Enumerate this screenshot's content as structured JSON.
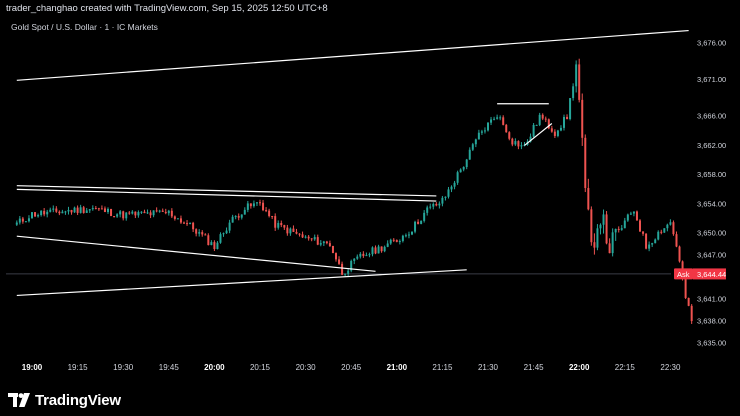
{
  "header": {
    "caption": "trader_changhao created with TradingView.com, Sep 15, 2025 12:50 UTC+8"
  },
  "footer": {
    "brand": "TradingView"
  },
  "chart_data": {
    "type": "candlestick",
    "title": "Gold Spot / U.S. Dollar · 1 · IC Markets",
    "symbol": "Gold Spot / U.S. Dollar",
    "interval": "1",
    "source": "IC Markets",
    "ylim": [
      3633.0,
      3678.0
    ],
    "y_ticks": [
      3676.0,
      3671.0,
      3666.0,
      3662.0,
      3658.0,
      3654.0,
      3650.0,
      3647.0,
      3641.0,
      3638.0,
      3635.0
    ],
    "y_tick_labels": [
      "3,676.00",
      "3,671.00",
      "3,666.00",
      "3,662.00",
      "3,658.00",
      "3,654.00",
      "3,650.00",
      "3,647.00",
      "3,641.00",
      "3,638.00",
      "3,635.00"
    ],
    "x_ticks": [
      {
        "time": "19:00",
        "bold": true
      },
      {
        "time": "19:15",
        "bold": false
      },
      {
        "time": "19:30",
        "bold": false
      },
      {
        "time": "19:45",
        "bold": false
      },
      {
        "time": "20:00",
        "bold": true
      },
      {
        "time": "20:15",
        "bold": false
      },
      {
        "time": "20:30",
        "bold": false
      },
      {
        "time": "20:45",
        "bold": false
      },
      {
        "time": "21:00",
        "bold": true
      },
      {
        "time": "21:15",
        "bold": false
      },
      {
        "time": "21:30",
        "bold": false
      },
      {
        "time": "21:45",
        "bold": false
      },
      {
        "time": "22:00",
        "bold": true
      },
      {
        "time": "22:15",
        "bold": false
      },
      {
        "time": "22:30",
        "bold": false
      }
    ],
    "ask": {
      "label": "Ask",
      "price_label": "3,644.44",
      "price": 3644.44
    },
    "colors": {
      "up": "#26a69a",
      "down": "#ef5350",
      "ask": "#f23645",
      "drawing": "#ffffff",
      "background": "#000000"
    },
    "keypoints": [
      {
        "time": "18:55",
        "price": 3651.3
      },
      {
        "time": "19:00",
        "price": 3652.6
      },
      {
        "time": "19:10",
        "price": 3653.0
      },
      {
        "time": "19:20",
        "price": 3653.4
      },
      {
        "time": "19:30",
        "price": 3652.5
      },
      {
        "time": "19:45",
        "price": 3652.8
      },
      {
        "time": "19:52",
        "price": 3651.0
      },
      {
        "time": "20:00",
        "price": 3648.2
      },
      {
        "time": "20:05",
        "price": 3651.5
      },
      {
        "time": "20:10",
        "price": 3653.4
      },
      {
        "time": "20:15",
        "price": 3654.2
      },
      {
        "time": "20:20",
        "price": 3651.2
      },
      {
        "time": "20:30",
        "price": 3649.3
      },
      {
        "time": "20:38",
        "price": 3648.5
      },
      {
        "time": "20:42",
        "price": 3644.6
      },
      {
        "time": "20:48",
        "price": 3646.8
      },
      {
        "time": "21:00",
        "price": 3649.0
      },
      {
        "time": "21:05",
        "price": 3650.6
      },
      {
        "time": "21:10",
        "price": 3653.2
      },
      {
        "time": "21:15",
        "price": 3654.4
      },
      {
        "time": "21:22",
        "price": 3659.4
      },
      {
        "time": "21:27",
        "price": 3663.4
      },
      {
        "time": "21:33",
        "price": 3666.3
      },
      {
        "time": "21:38",
        "price": 3662.6
      },
      {
        "time": "21:42",
        "price": 3661.8
      },
      {
        "time": "21:47",
        "price": 3666.0
      },
      {
        "time": "21:52",
        "price": 3663.8
      },
      {
        "time": "21:56",
        "price": 3665.9
      },
      {
        "time": "21:59",
        "price": 3672.8
      },
      {
        "time": "22:00",
        "price": 3668.0
      },
      {
        "time": "22:02",
        "price": 3655.5
      },
      {
        "time": "22:04",
        "price": 3648.0
      },
      {
        "time": "22:07",
        "price": 3652.6
      },
      {
        "time": "22:10",
        "price": 3648.1
      },
      {
        "time": "22:14",
        "price": 3650.9
      },
      {
        "time": "22:18",
        "price": 3653.2
      },
      {
        "time": "22:22",
        "price": 3648.2
      },
      {
        "time": "22:27",
        "price": 3650.5
      },
      {
        "time": "22:30",
        "price": 3651.5
      },
      {
        "time": "22:32",
        "price": 3648.4
      },
      {
        "time": "22:35",
        "price": 3641.2
      },
      {
        "time": "22:37",
        "price": 3638.0
      }
    ],
    "trendlines": [
      {
        "from": {
          "time": "18:55",
          "price": 3670.9
        },
        "to": {
          "time": "22:36",
          "price": 3677.7
        }
      },
      {
        "from": {
          "time": "18:55",
          "price": 3656.5
        },
        "to": {
          "time": "21:13",
          "price": 3655.1
        }
      },
      {
        "from": {
          "time": "18:55",
          "price": 3656.0
        },
        "to": {
          "time": "21:13",
          "price": 3654.4
        }
      },
      {
        "from": {
          "time": "18:55",
          "price": 3649.6
        },
        "to": {
          "time": "20:53",
          "price": 3644.8
        }
      },
      {
        "from": {
          "time": "18:55",
          "price": 3641.5
        },
        "to": {
          "time": "21:23",
          "price": 3645.0
        }
      },
      {
        "from": {
          "time": "21:33",
          "price": 3667.7
        },
        "to": {
          "time": "21:50",
          "price": 3667.7
        }
      },
      {
        "from": {
          "time": "21:42",
          "price": 3662.0
        },
        "to": {
          "time": "21:51",
          "price": 3665.0
        }
      }
    ]
  }
}
